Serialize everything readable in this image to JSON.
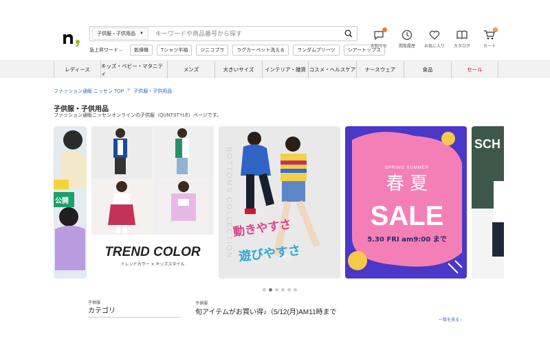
{
  "search": {
    "category": "子供服・子供用品",
    "placeholder": "キーワードや商品番号から探す"
  },
  "hot_words": {
    "label": "急上昇ワード→",
    "items": [
      "乾燥機",
      "Tシャツ半袖",
      "ジニコプラ",
      "ラグカーペット洗える",
      "ランダムプリーツ",
      "シアートップス"
    ]
  },
  "utility": {
    "notifications": "お知らせ",
    "history": "閲覧履歴",
    "favorites": "お気に入り",
    "catalog": "カタログ",
    "cart": "カート",
    "cart_count": "0"
  },
  "nav": [
    "レディース",
    "キッズ・ベビー・マタニティ",
    "メンズ",
    "大きいサイズ",
    "インテリア・雑貨",
    "コスメ・ヘルスケア",
    "ナースウェア",
    "食品",
    "セール"
  ],
  "breadcrumb": {
    "home": "ファッション通販 ニッセン TOP",
    "sep": ">",
    "current": "子供服・子供用品"
  },
  "page": {
    "title": "子供服・子供用品",
    "description": "ファッション通販ニッセンオンラインの子供服（QUNTSTYLE）ページです。"
  },
  "slides": {
    "s0_badge": "公開",
    "s1_title": "TREND COLOR",
    "s1_sub": "トレンドカラー × キッズスタイル",
    "s2_vertical": "BOTTOMS COLLECTION",
    "s2_line1": "動きやすさ",
    "s2_line2": "遊びやすさ",
    "s3_top": "SPRING SUMMER",
    "s3_kanji": "春 夏",
    "s3_sale": "SALE",
    "s3_date": "5.30 FRI am9:00 まで",
    "s4_text": "SCH"
  },
  "carousel": {
    "slide_count": 6,
    "active_index": 1
  },
  "category_block": {
    "small": "子供服",
    "title": "カテゴリ"
  },
  "promo_block": {
    "small": "子供服",
    "title": "旬アイテムがお買い得♪（5/12(月)AM11時まで",
    "more": "一覧を見る ›"
  },
  "colors": {
    "accent": "#f08020",
    "sale_red": "#d0021b",
    "link": "#2a6ab0",
    "sale_pink": "#f47fb6"
  }
}
